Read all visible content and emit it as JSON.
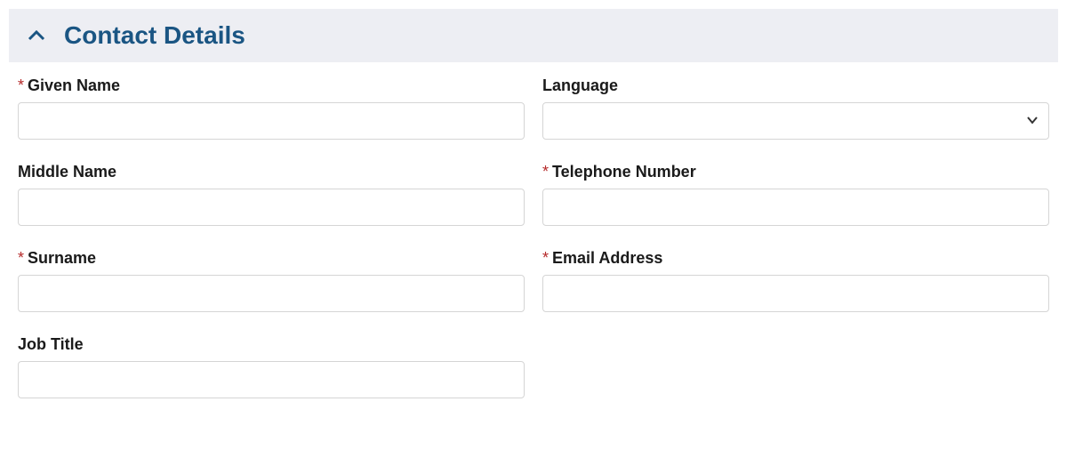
{
  "section": {
    "title": "Contact Details"
  },
  "fields": {
    "givenName": {
      "label": "Given Name",
      "required": true,
      "value": ""
    },
    "middleName": {
      "label": "Middle Name",
      "required": false,
      "value": ""
    },
    "surname": {
      "label": "Surname",
      "required": true,
      "value": ""
    },
    "jobTitle": {
      "label": "Job Title",
      "required": false,
      "value": ""
    },
    "language": {
      "label": "Language",
      "required": false,
      "value": ""
    },
    "telephone": {
      "label": "Telephone Number",
      "required": true,
      "value": ""
    },
    "email": {
      "label": "Email Address",
      "required": true,
      "value": ""
    }
  },
  "requiredMark": "*"
}
